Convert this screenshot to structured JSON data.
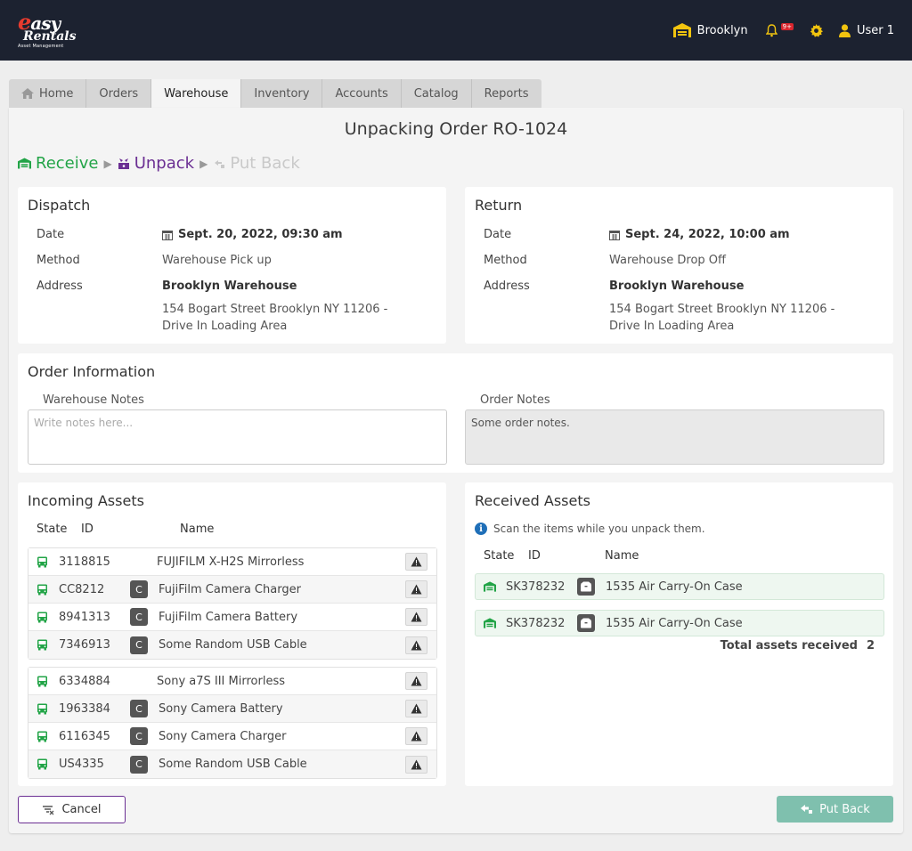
{
  "app": {
    "logo_line1": "easy",
    "logo_line2": "Rentals",
    "logo_line3": "Asset Management",
    "location": "Brooklyn",
    "notif_count": "9+",
    "user": "User 1"
  },
  "tabs": [
    {
      "label": "Home",
      "icon": "home-icon"
    },
    {
      "label": "Orders"
    },
    {
      "label": "Warehouse",
      "active": true
    },
    {
      "label": "Inventory"
    },
    {
      "label": "Accounts"
    },
    {
      "label": "Catalog"
    },
    {
      "label": "Reports"
    }
  ],
  "page": {
    "title": "Unpacking Order RO-1024",
    "steps": {
      "receive": "Receive",
      "unpack": "Unpack",
      "putback": "Put Back"
    }
  },
  "dispatch": {
    "title": "Dispatch",
    "date_label": "Date",
    "date": "Sept. 20, 2022, 09:30 am",
    "method_label": "Method",
    "method": "Warehouse Pick up",
    "address_label": "Address",
    "address_name": "Brooklyn Warehouse",
    "address_line1": "154 Bogart Street Brooklyn NY 11206 -",
    "address_line2": "Drive In Loading Area"
  },
  "return": {
    "title": "Return",
    "date_label": "Date",
    "date": "Sept. 24, 2022, 10:00 am",
    "method_label": "Method",
    "method": "Warehouse Drop Off",
    "address_label": "Address",
    "address_name": "Brooklyn Warehouse",
    "address_line1": "154 Bogart Street Brooklyn NY 11206 -",
    "address_line2": "Drive In Loading Area"
  },
  "order_info": {
    "title": "Order Information",
    "warehouse_notes_label": "Warehouse Notes",
    "warehouse_notes_placeholder": "Write notes here...",
    "order_notes_label": "Order Notes",
    "order_notes": "Some order notes."
  },
  "incoming": {
    "title": "Incoming Assets",
    "col_state": "State",
    "col_id": "ID",
    "col_name": "Name",
    "groups": [
      [
        {
          "id": "3118815",
          "name": "FUJIFILM X-H2S Mirrorless",
          "component": false
        },
        {
          "id": "CC8212",
          "name": "FujiFilm Camera Charger",
          "component": true
        },
        {
          "id": "8941313",
          "name": "FujiFilm Camera Battery",
          "component": true
        },
        {
          "id": "7346913",
          "name": "Some Random USB Cable",
          "component": true
        }
      ],
      [
        {
          "id": "6334884",
          "name": "Sony a7S III Mirrorless",
          "component": false
        },
        {
          "id": "1963384",
          "name": "Sony Camera Battery",
          "component": true
        },
        {
          "id": "6116345",
          "name": "Sony Camera Charger",
          "component": true
        },
        {
          "id": "US4335",
          "name": "Some Random USB Cable",
          "component": true
        }
      ]
    ],
    "component_letter": "C"
  },
  "received": {
    "title": "Received Assets",
    "info": "Scan the items while you unpack them.",
    "col_state": "State",
    "col_id": "ID",
    "col_name": "Name",
    "rows": [
      {
        "id": "SK378232",
        "name": "1535 Air Carry-On Case"
      },
      {
        "id": "SK378232",
        "name": "1535 Air Carry-On Case"
      }
    ],
    "total_label": "Total assets received",
    "total": "2"
  },
  "actions": {
    "cancel": "Cancel",
    "put_back": "Put Back"
  },
  "colors": {
    "accent_green": "#22a447",
    "accent_purple": "#6b2f93",
    "put_back_btn": "#7fc0ae",
    "topbar": "#1c2230"
  }
}
